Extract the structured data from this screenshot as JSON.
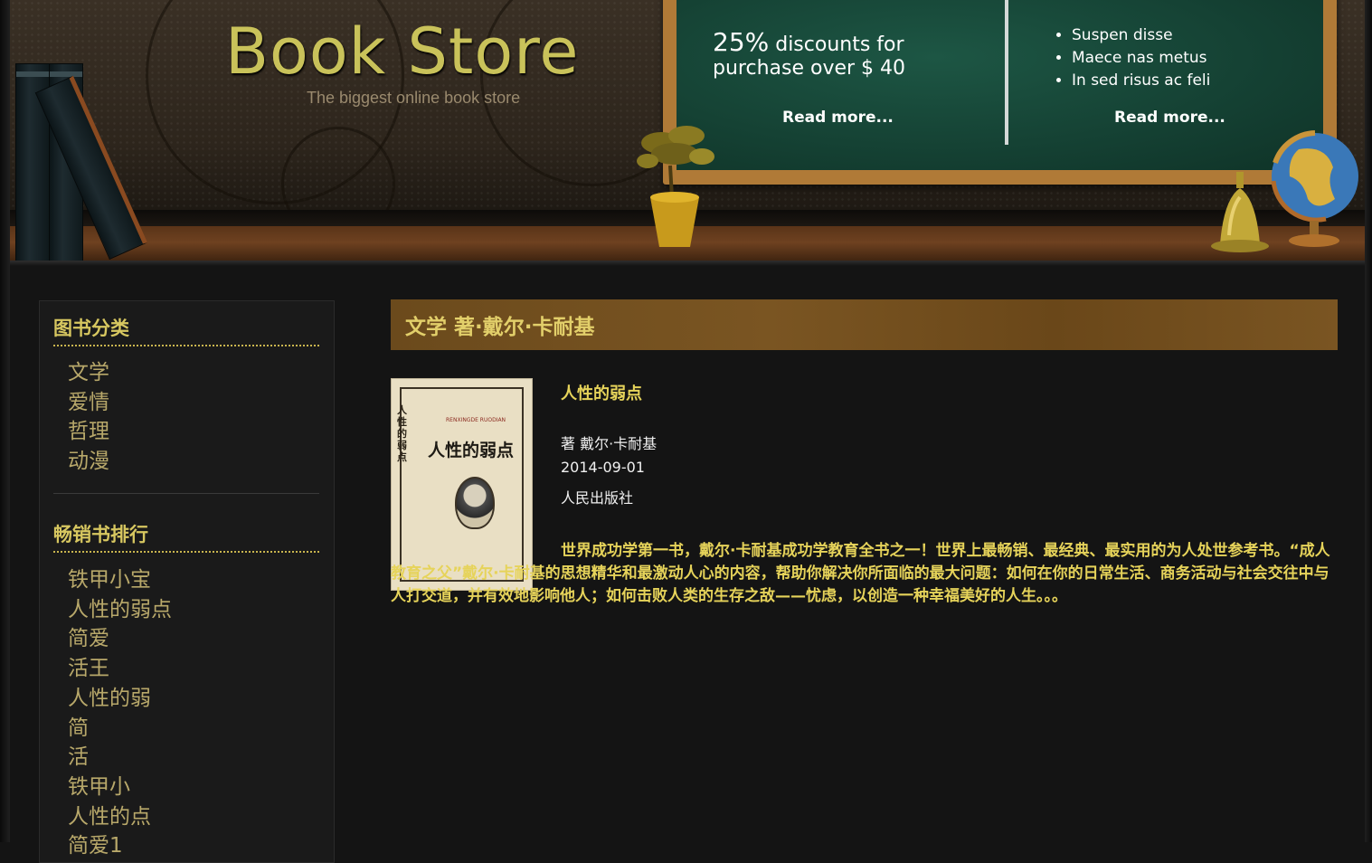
{
  "header": {
    "title": "Book Store",
    "subtitle": "The biggest online book store",
    "promo": {
      "discount_percent": "25%",
      "discount_text": " discounts for",
      "discount_text2": "purchase over $ 40",
      "read_more_left": "Read more...",
      "list": [
        "Suspen disse",
        "Maece nas metus",
        "In sed risus ac feli"
      ],
      "read_more_right": "Read more..."
    }
  },
  "sidebar": {
    "categories_title": "图书分类",
    "categories": [
      "文学",
      "爱情",
      "哲理",
      "动漫"
    ],
    "bestsellers_title": "畅销书排行",
    "bestsellers": [
      "铁甲小宝",
      "人性的弱点",
      "简爱",
      "活王",
      "人性的弱",
      "简",
      "活",
      "铁甲小",
      "人性的点",
      "简爱1"
    ]
  },
  "main": {
    "heading": "文学 著·戴尔·卡耐基",
    "book": {
      "title": "人性的弱点",
      "author": "著 戴尔·卡耐基",
      "date": "2014-09-01",
      "publisher": "人民出版社",
      "description": "世界成功学第一书，戴尔·卡耐基成功学教育全书之一！世界上最畅销、最经典、最实用的为人处世参考书。“成人教育之父”戴尔·卡耐基的思想精华和最激动人心的内容，帮助你解决你所面临的最大问题：如何在你的日常生活、商务活动与社会交往中与人打交道，并有效地影响他人；如何击败人类的生存之敌——忧虑，以创造一种幸福美好的人生。。。",
      "cover": {
        "spine": "人性的弱点",
        "en_title": "RENXINGDE RUODIAN",
        "cn_title": "人性的弱点"
      }
    }
  },
  "colors": {
    "accent_gold": "#e6d35a",
    "heading_bar": "#7a5522",
    "board_green": "#1d5644",
    "link_muted": "#b8a86a"
  }
}
